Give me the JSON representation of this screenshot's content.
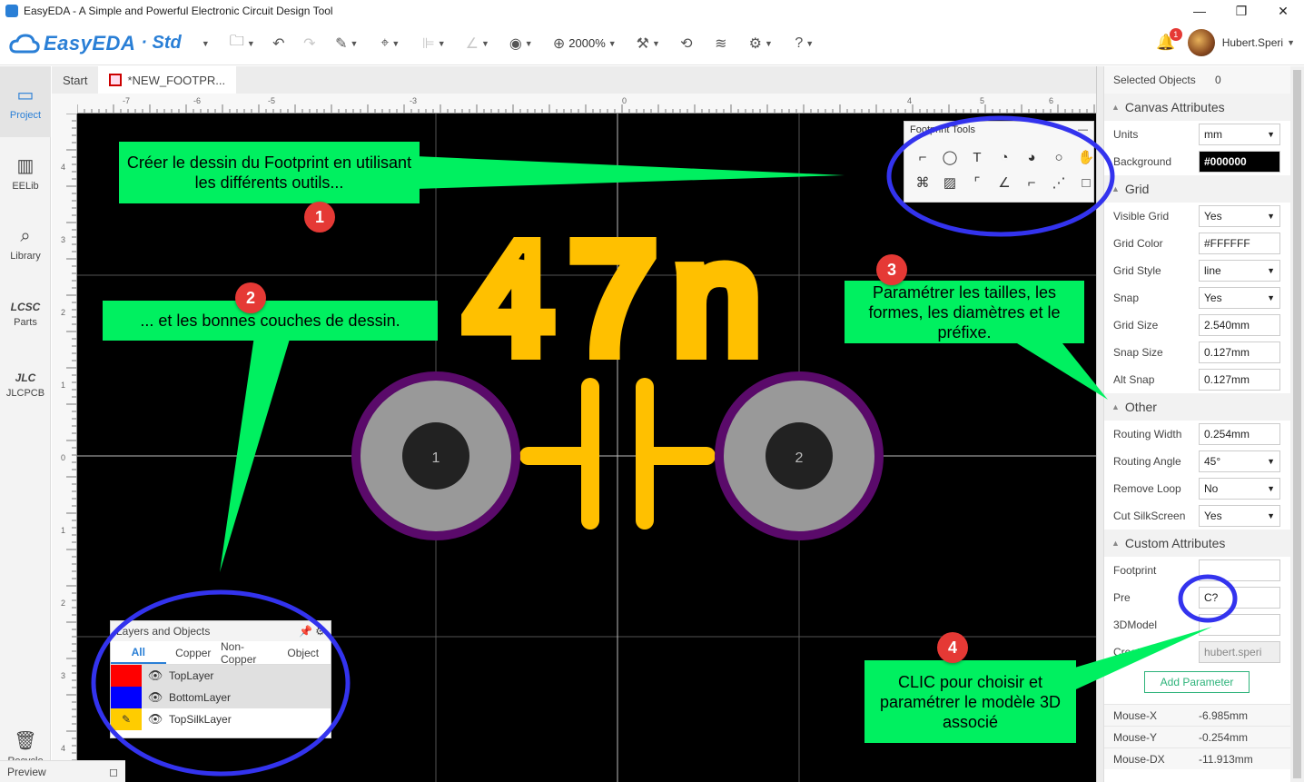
{
  "window": {
    "title": "EasyEDA - A Simple and Powerful Electronic Circuit Design Tool"
  },
  "toolbar": {
    "brand": "EasyEDA",
    "edition": "· Std",
    "zoom": "2000%"
  },
  "user": {
    "name": "Hubert.Speri",
    "notifications": "1"
  },
  "nav": [
    {
      "label": "Project",
      "icon": "folder-icon"
    },
    {
      "label": "EELib",
      "icon": "chip-icon"
    },
    {
      "label": "Library",
      "icon": "library-icon"
    },
    {
      "label": "Parts",
      "icon": "lcsc-icon"
    },
    {
      "label": "JLCPCB",
      "icon": "jlc-icon"
    }
  ],
  "nav_recycle": "Recycle",
  "preview_label": "Preview",
  "tabs": [
    {
      "label": "Start"
    },
    {
      "label": "*NEW_FOOTPR..."
    }
  ],
  "ruler": {
    "h": [
      "-7",
      "-6",
      "-5",
      "-3",
      "0",
      "4",
      "5",
      "6"
    ],
    "v": [
      "4",
      "3",
      "2",
      "1",
      "0",
      "1",
      "2",
      "3",
      "4"
    ]
  },
  "footprint": {
    "silk_text": "47n",
    "pad1": "1",
    "pad2": "2",
    "silk_color": "#FFC000",
    "pad_color": "#999999",
    "pad_ring_color": "#5a0a6a"
  },
  "footprint_tools": {
    "title": "Footprint Tools"
  },
  "layers_panel": {
    "title": "Layers and Objects",
    "tabs": [
      "All",
      "Copper",
      "Non-Copper",
      "Object"
    ],
    "layers": [
      {
        "name": "TopLayer",
        "color": "#FF0000"
      },
      {
        "name": "BottomLayer",
        "color": "#0000FF"
      },
      {
        "name": "TopSilkLayer",
        "color": "#FFCC00"
      }
    ]
  },
  "callouts": {
    "c1": "Créer le dessin du Footprint en utilisant les différents outils...",
    "c2": "... et les bonnes couches de dessin.",
    "c3": "Paramétrer les tailles, les formes, les diamètres et le préfixe.",
    "c4": "CLIC pour choisir et paramétrer le modèle 3D associé",
    "n1": "1",
    "n2": "2",
    "n3": "3",
    "n4": "4"
  },
  "right": {
    "selected_label": "Selected Objects",
    "selected_count": "0",
    "canvas_section": "Canvas Attributes",
    "units_label": "Units",
    "units": "mm",
    "bg_label": "Background",
    "bg": "#000000",
    "grid_section": "Grid",
    "visible_grid_label": "Visible Grid",
    "visible_grid": "Yes",
    "grid_color_label": "Grid Color",
    "grid_color": "#FFFFFF",
    "grid_style_label": "Grid Style",
    "grid_style": "line",
    "snap_label": "Snap",
    "snap": "Yes",
    "grid_size_label": "Grid Size",
    "grid_size": "2.540mm",
    "snap_size_label": "Snap Size",
    "snap_size": "0.127mm",
    "alt_snap_label": "Alt Snap",
    "alt_snap": "0.127mm",
    "other_section": "Other",
    "routing_width_label": "Routing Width",
    "routing_width": "0.254mm",
    "routing_angle_label": "Routing Angle",
    "routing_angle": "45°",
    "remove_loop_label": "Remove Loop",
    "remove_loop": "No",
    "cut_silk_label": "Cut SilkScreen",
    "cut_silk": "Yes",
    "custom_section": "Custom Attributes",
    "footprint_label": "Footprint",
    "footprint": "",
    "pre_label": "Pre",
    "pre": "C?",
    "model3d_label": "3DModel",
    "model3d": "",
    "creator_label": "Creator",
    "creator": "hubert.speri",
    "add_param": "Add Parameter",
    "mouse": [
      {
        "label": "Mouse-X",
        "value": "-6.985mm"
      },
      {
        "label": "Mouse-Y",
        "value": "-0.254mm"
      },
      {
        "label": "Mouse-DX",
        "value": "-11.913mm"
      }
    ]
  }
}
